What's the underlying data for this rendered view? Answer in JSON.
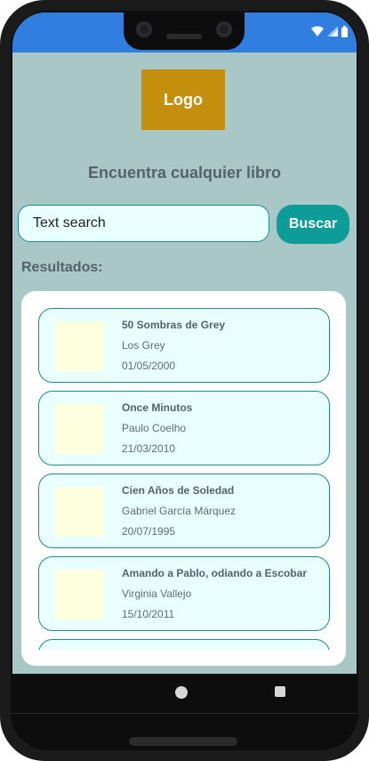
{
  "app": {
    "logo_text": "Logo",
    "headline": "Encuentra cualquier libro",
    "search": {
      "value": "Text search",
      "button_label": "Buscar"
    },
    "results_label": "Resultados:",
    "books": [
      {
        "title": "50 Sombras de Grey",
        "author": "Los Grey",
        "date": "01/05/2000"
      },
      {
        "title": "Once Minutos",
        "author": "Paulo Coelho",
        "date": "21/03/2010"
      },
      {
        "title": "Cien Años de Soledad",
        "author": "Gabriel García Márquez",
        "date": "20/07/1995"
      },
      {
        "title": "Amando a Pablo, odiando a Escobar",
        "author": "Virginia Vallejo",
        "date": "15/10/2011"
      },
      {
        "title": "",
        "author": "",
        "date": ""
      }
    ]
  },
  "status_bar": {
    "icons": [
      "wifi-icon",
      "signal-icon",
      "battery-icon"
    ]
  },
  "colors": {
    "status_bar": "#2f7ee0",
    "background": "#a9c7c7",
    "logo": "#c58f0e",
    "accent": "#0e9c98",
    "card_fill": "#e9ffff",
    "card_border": "#1c8b90",
    "thumbnail": "#fdffde"
  }
}
